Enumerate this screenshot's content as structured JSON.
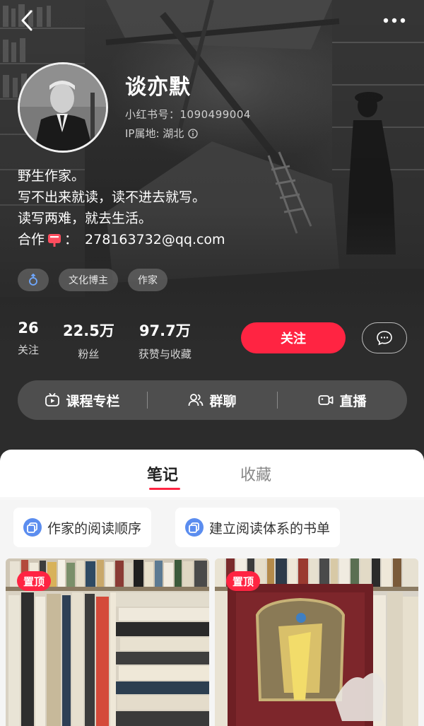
{
  "profile": {
    "name": "谈亦默",
    "id_line": "小红书号：1090499004",
    "ip_line": "IP属地: 湖北",
    "bio_lines": [
      "野生作家。",
      "写不出来就读，读不进去就写。",
      "读写两难，就去生活。"
    ],
    "contact_prefix": "合作",
    "contact_sep": "：",
    "contact_email": "278163732@qq.com",
    "tags": [
      "文化博主",
      "作家"
    ]
  },
  "stats": [
    {
      "num": "26",
      "label": "关注"
    },
    {
      "num": "22.5万",
      "label": "粉丝"
    },
    {
      "num": "97.7万",
      "label": "获赞与收藏"
    }
  ],
  "actions": {
    "follow": "关注"
  },
  "features": [
    {
      "label": "课程专栏",
      "icon": "tv-play-icon"
    },
    {
      "label": "群聊",
      "icon": "group-icon"
    },
    {
      "label": "直播",
      "icon": "live-camera-icon"
    }
  ],
  "tabs": {
    "notes": "笔记",
    "favorites": "收藏"
  },
  "collections": [
    "作家的阅读顺序",
    "建立阅读体系的书单"
  ],
  "cards": [
    {
      "badge": "置顶"
    },
    {
      "badge": "置顶"
    }
  ],
  "colors": {
    "accent": "#ff2442",
    "header_bg": "#2c2c2c"
  }
}
